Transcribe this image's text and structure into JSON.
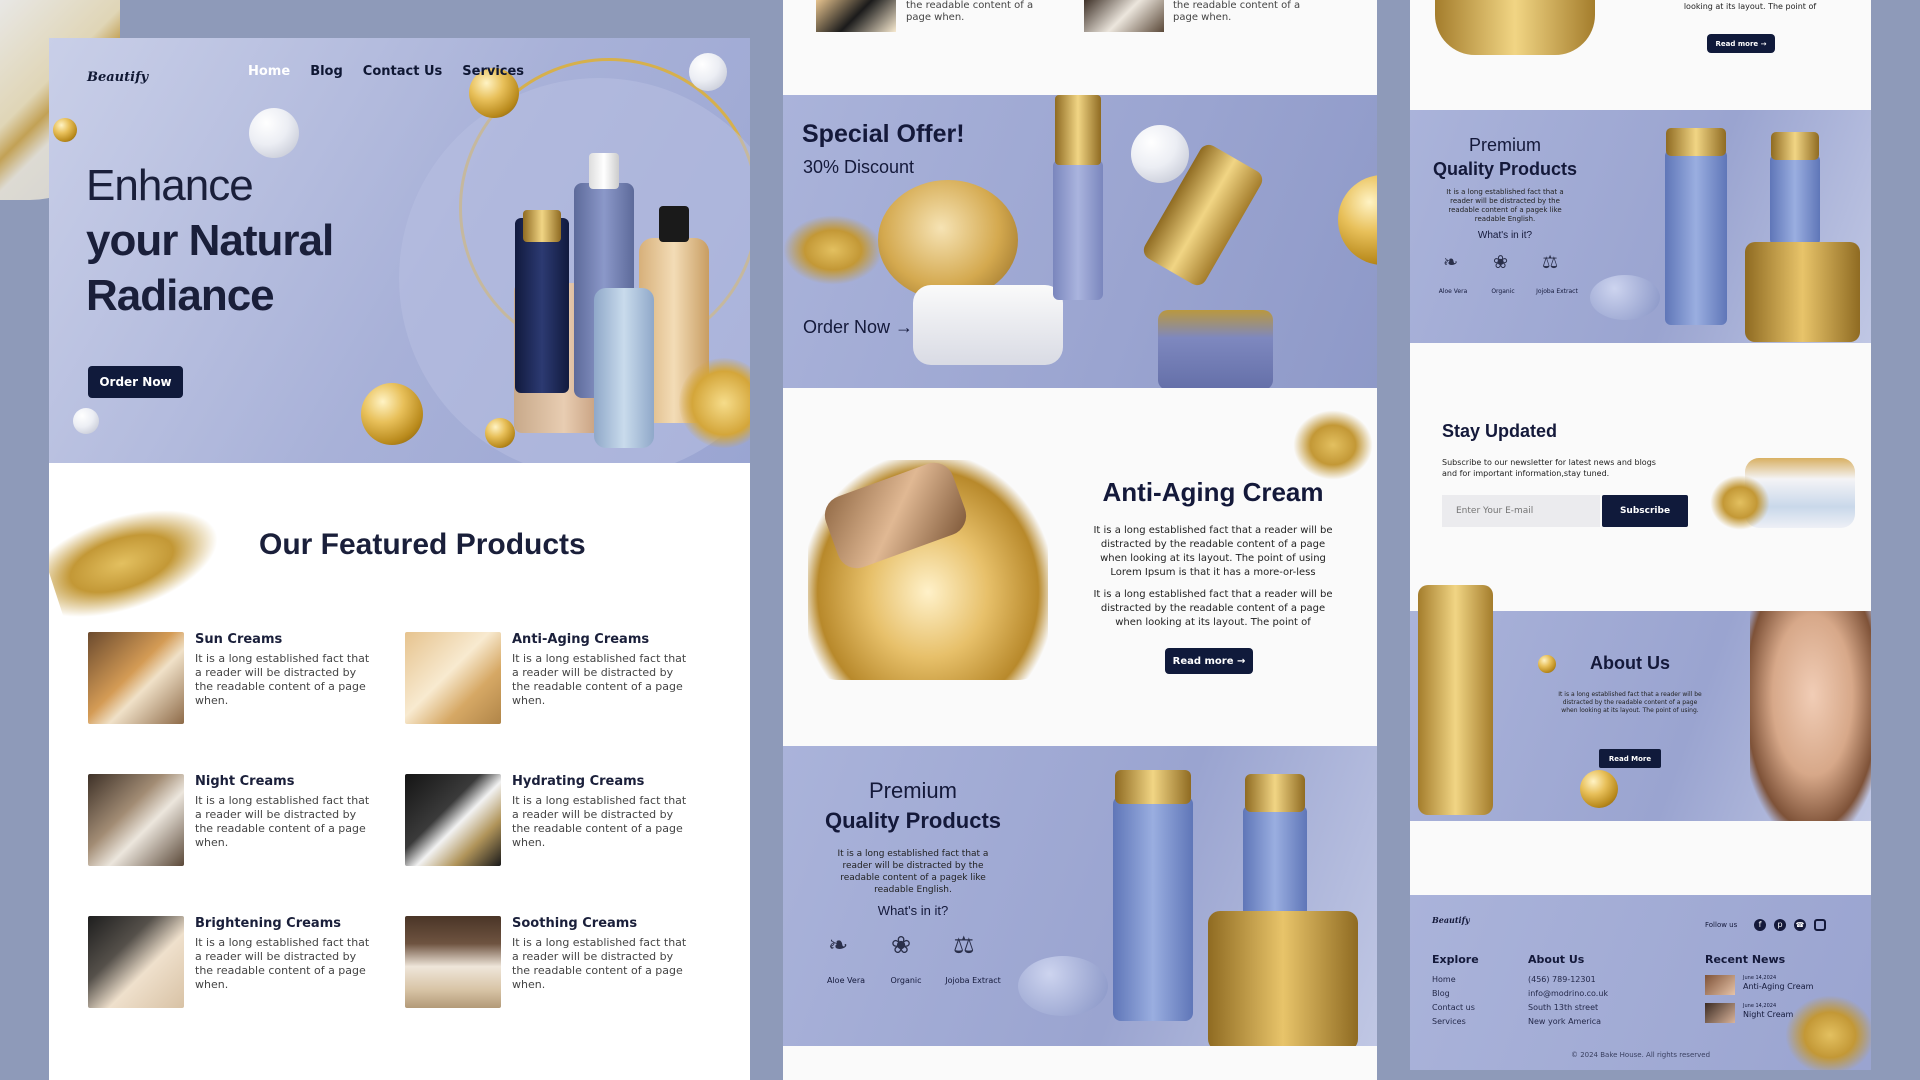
{
  "left": {
    "logo": "Beautify",
    "nav": [
      "Home",
      "Blog",
      "Contact Us",
      "Services"
    ],
    "hero": {
      "line1": "Enhance",
      "line2": "your Natural",
      "line3": "Radiance",
      "cta": "Order Now"
    },
    "featured_title": "Our Featured Products",
    "products": [
      {
        "title": "Sun Creams",
        "desc": "It is a long established fact that a reader will be distracted by the readable content of a page when."
      },
      {
        "title": "Anti-Aging Creams",
        "desc": "It is a long established fact that a reader will be distracted by the readable content of a page when."
      },
      {
        "title": "Night Creams",
        "desc": "It is a long established fact that a reader will be distracted by the readable content of a page when."
      },
      {
        "title": "Hydrating Creams",
        "desc": "It is a long established fact that a reader will be distracted by the readable content of a page when."
      },
      {
        "title": "Brightening Creams",
        "desc": "It is a long established fact that a reader will be distracted by the readable content of a page when."
      },
      {
        "title": "Soothing Creams",
        "desc": "It is a long established fact that a reader will be distracted by the readable content of a page when."
      }
    ]
  },
  "middle": {
    "top_snips": [
      "the readable content of a page when.",
      "the readable content of a page when."
    ],
    "offer": {
      "title": "Special Offer!",
      "discount": "30% Discount",
      "cta": "Order Now →"
    },
    "anti_aging": {
      "title": "Anti-Aging Cream",
      "p1": "It is a long established fact that a reader will be distracted by the readable content of a page when looking at its layout. The point of using Lorem Ipsum is that it has a more-or-less",
      "p2": "It is a long established fact that a reader will be distracted by the readable content of a page when looking at its layout. The point of",
      "cta": "Read more →"
    },
    "premium": {
      "line1": "Premium",
      "line2": "Quality Products",
      "desc": "It is a long established fact that a reader will be distracted by the readable content of a pagek like readable English.",
      "whats": "What's in it?",
      "ingredients": [
        "Aloe Vera",
        "Organic",
        "Jojoba Extract"
      ]
    }
  },
  "right": {
    "top_snip": "looking at its layout. The point of",
    "top_cta": "Read more →",
    "premium": {
      "line1": "Premium",
      "line2": "Quality Products",
      "desc": "It is a long established fact that a reader will be distracted by the readable content of a pagek like readable English.",
      "whats": "What's in it?",
      "ingredients": [
        "Aloe Vera",
        "Organic",
        "Jojoba Extract"
      ]
    },
    "newsletter": {
      "title": "Stay Updated",
      "desc": "Subscribe to our newsletter for latest news and blogs and for important information,stay tuned.",
      "placeholder": "Enter Your E-mail",
      "button": "Subscribe"
    },
    "about": {
      "title": "About Us",
      "desc": "It is a long established fact that a reader will be distracted by the readable content of a page when looking at its layout. The point of using.",
      "cta": "Read More"
    },
    "footer": {
      "logo": "Beautify",
      "follow": "Follow us",
      "explore_title": "Explore",
      "explore": [
        "Home",
        "Blog",
        "Contact us",
        "Services"
      ],
      "about_title": "About Us",
      "about": [
        "(456) 789-12301",
        "info@modrino.co.uk",
        "South 13th street",
        "New york America"
      ],
      "news_title": "Recent News",
      "news": [
        {
          "date": "June 14,2024",
          "title": "Anti-Aging Cream"
        },
        {
          "date": "June 14,2024",
          "title": "Night Cream"
        }
      ],
      "copyright": "© 2024 Bake House. All rights reserved"
    }
  },
  "colors": {
    "navy": "#101a3b",
    "lavender": "#a8b1d8",
    "gold": "#d4a63a",
    "background": "#8e9ab9"
  }
}
